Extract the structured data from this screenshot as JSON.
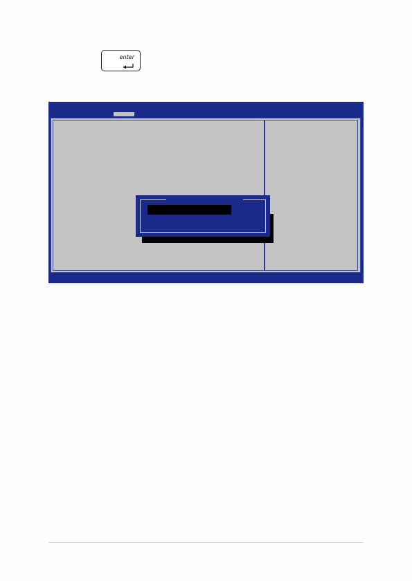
{
  "key": {
    "label": "enter",
    "icon": "enter-arrow-icon"
  },
  "colors": {
    "bios_blue": "#1a2a8a",
    "bios_gray": "#c4c4c4",
    "dialog_border": "#c8ccee",
    "input_black": "#000000"
  }
}
